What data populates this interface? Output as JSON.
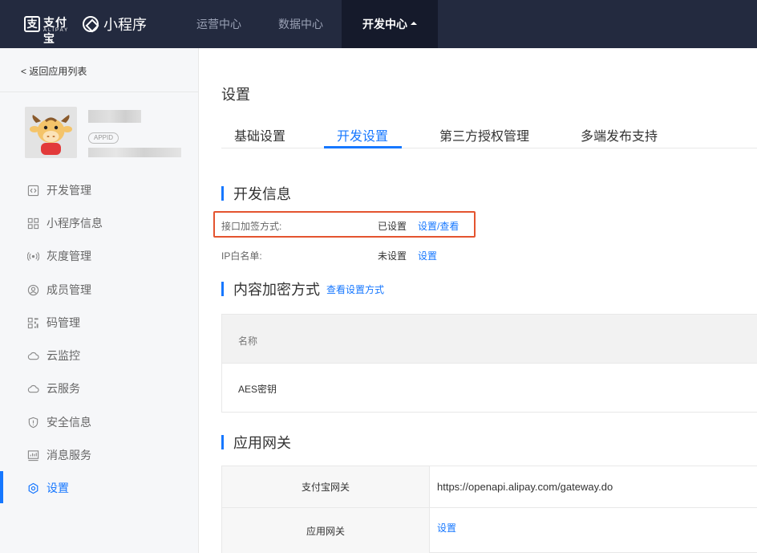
{
  "topbar": {
    "brand_box": "支",
    "brand_name": "支付宝",
    "brand_sub": "ALIPAY",
    "product_name": "小程序",
    "nav": [
      "运营中心",
      "数据中心",
      "开发中心"
    ],
    "active_nav": "开发中心"
  },
  "sidebar": {
    "back_label": "返回应用列表",
    "appid_badge": "APPID",
    "items": [
      {
        "label": "开发管理",
        "icon": "code-icon"
      },
      {
        "label": "小程序信息",
        "icon": "grid-icon"
      },
      {
        "label": "灰度管理",
        "icon": "broadcast-icon"
      },
      {
        "label": "成员管理",
        "icon": "user-circle-icon"
      },
      {
        "label": "码管理",
        "icon": "qrcode-icon"
      },
      {
        "label": "云监控",
        "icon": "cloud-icon"
      },
      {
        "label": "云服务",
        "icon": "cloud-icon"
      },
      {
        "label": "安全信息",
        "icon": "shield-icon"
      },
      {
        "label": "消息服务",
        "icon": "message-chart-icon"
      },
      {
        "label": "设置",
        "icon": "gear-icon"
      }
    ],
    "active_item": "设置"
  },
  "main": {
    "page_title": "设置",
    "tabs": [
      "基础设置",
      "开发设置",
      "第三方授权管理",
      "多端发布支持"
    ],
    "active_tab": "开发设置",
    "dev_info": {
      "title": "开发信息",
      "rows": [
        {
          "label": "接口加签方式:",
          "status": "已设置",
          "action": "设置/查看"
        },
        {
          "label": "IP白名单:",
          "status": "未设置",
          "action": "设置"
        }
      ]
    },
    "content_encrypt": {
      "title": "内容加密方式",
      "link": "查看设置方式",
      "table_header": "名称",
      "table_rows": [
        "AES密钥"
      ]
    },
    "gateway": {
      "title": "应用网关",
      "rows": [
        {
          "key": "支付宝网关",
          "value": "https://openapi.alipay.com/gateway.do"
        },
        {
          "key": "应用网关",
          "value": "设置"
        }
      ]
    }
  },
  "colors": {
    "topbar_bg": "#232a3f",
    "accent": "#1677ff",
    "highlight_border": "#e4542f"
  }
}
